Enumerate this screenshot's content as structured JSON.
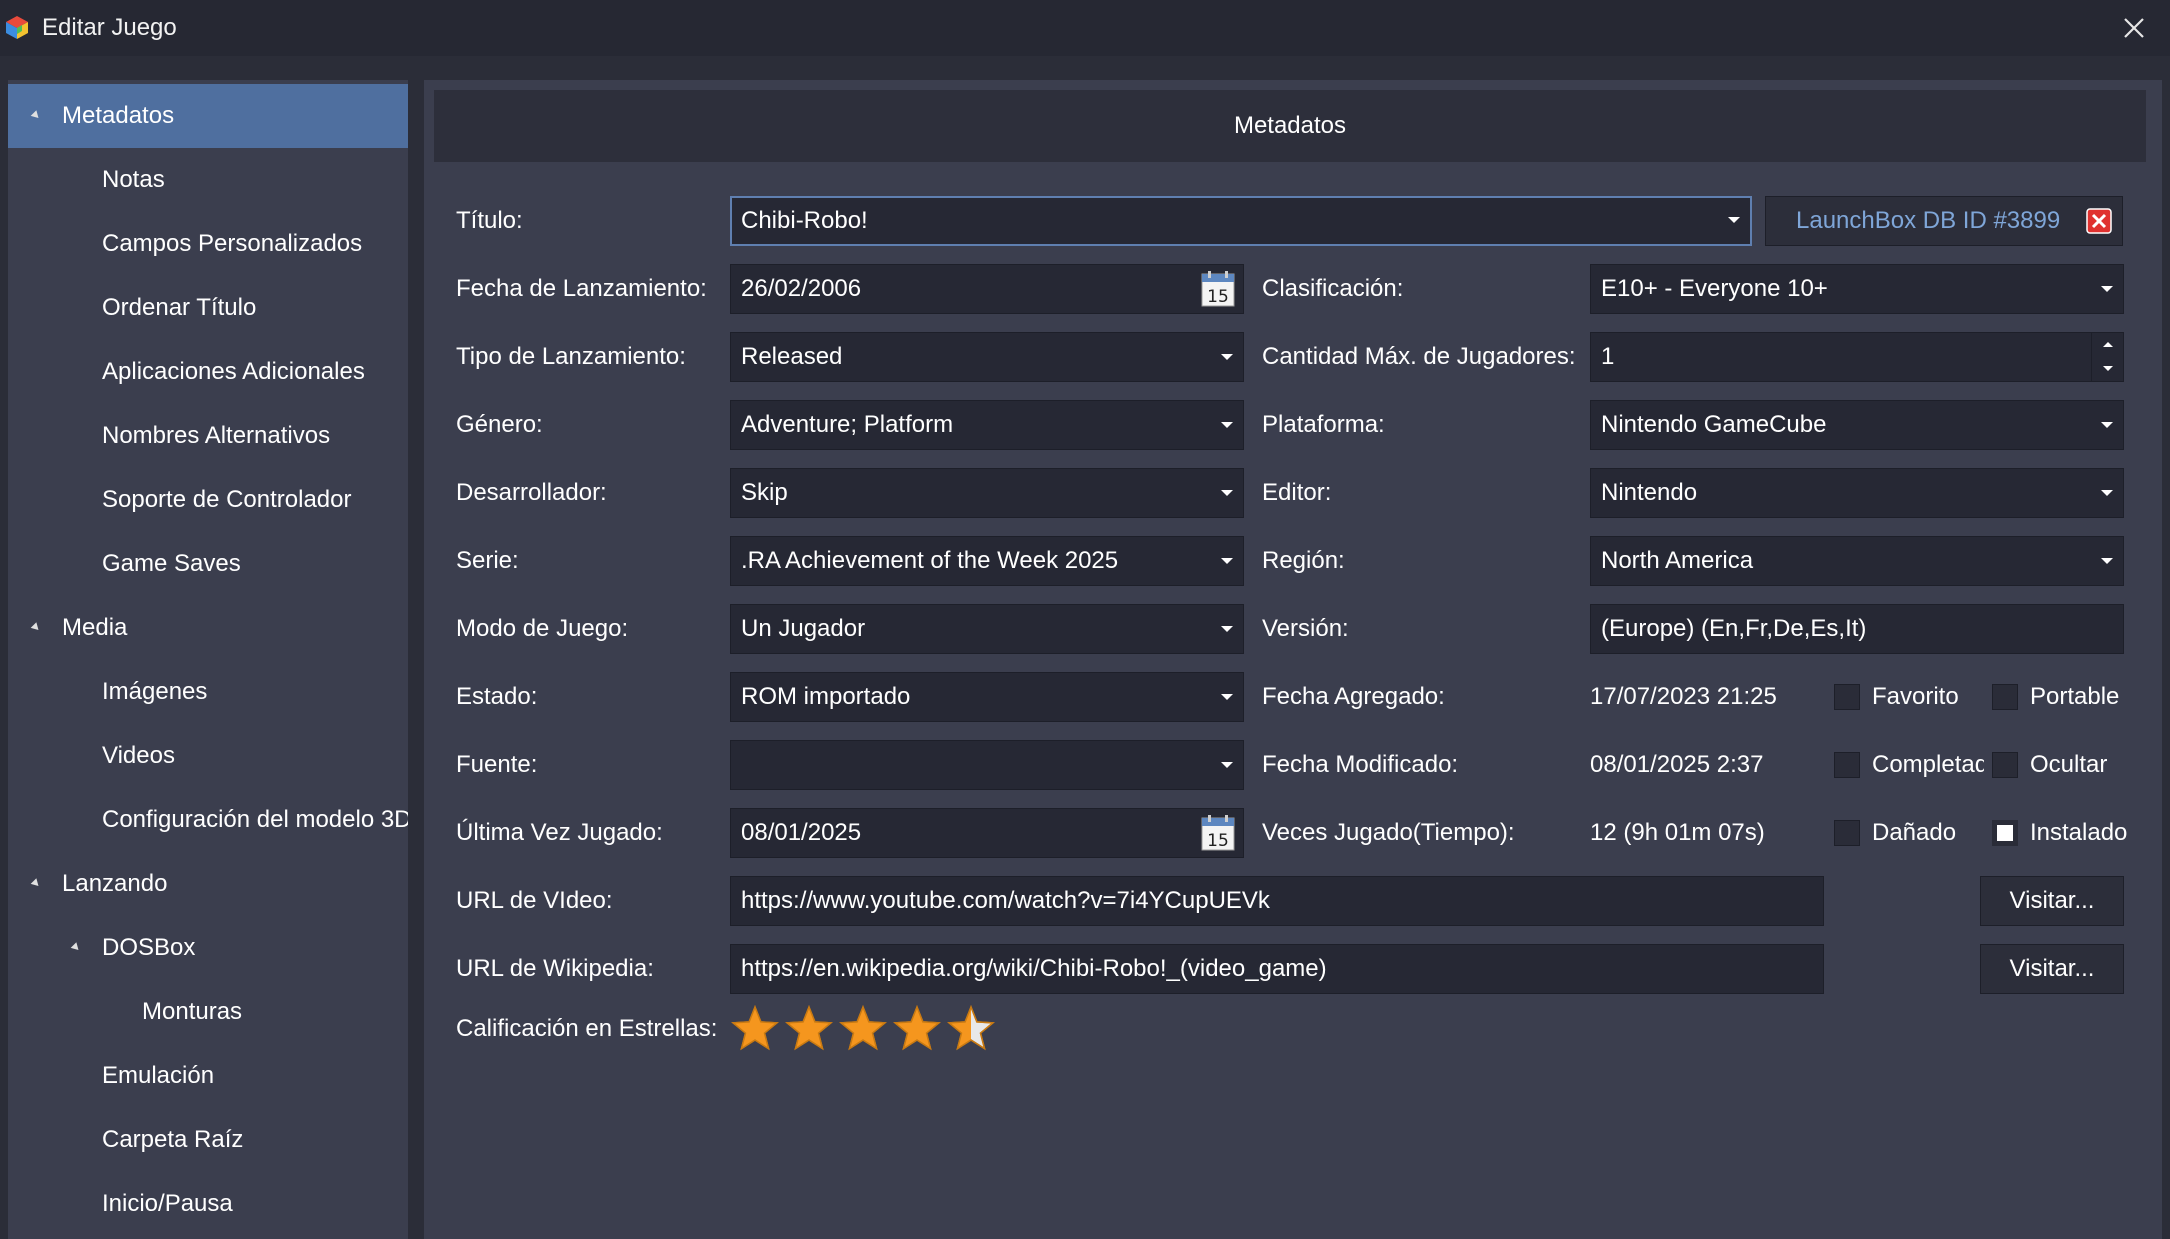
{
  "window": {
    "title": "Editar Juego",
    "app_icon": "launchbox-cube-icon",
    "close_icon": "close-icon"
  },
  "sidebar": {
    "items": [
      {
        "label": "Metadatos",
        "level": 0,
        "expanded": true,
        "selected": true
      },
      {
        "label": "Notas",
        "level": 1
      },
      {
        "label": "Campos Personalizados",
        "level": 1
      },
      {
        "label": "Ordenar Título",
        "level": 1
      },
      {
        "label": "Aplicaciones Adicionales",
        "level": 1
      },
      {
        "label": "Nombres Alternativos",
        "level": 1
      },
      {
        "label": "Soporte de Controlador",
        "level": 1
      },
      {
        "label": "Game Saves",
        "level": 1
      },
      {
        "label": "Media",
        "level": 0,
        "expanded": true
      },
      {
        "label": "Imágenes",
        "level": 1
      },
      {
        "label": "Videos",
        "level": 1
      },
      {
        "label": "Configuración del modelo 3D",
        "level": 1
      },
      {
        "label": "Lanzando",
        "level": 0,
        "expanded": true
      },
      {
        "label": "DOSBox",
        "level": 1,
        "expanded": true
      },
      {
        "label": "Monturas",
        "level": 2
      },
      {
        "label": "Emulación",
        "level": 1
      },
      {
        "label": "Carpeta Raíz",
        "level": 1
      },
      {
        "label": "Inicio/Pausa",
        "level": 1
      }
    ]
  },
  "panel": {
    "title": "Metadatos"
  },
  "form": {
    "title": {
      "label": "Título:",
      "value": "Chibi-Robo!"
    },
    "launchbox_db": {
      "label": "LaunchBox DB ID #3899"
    },
    "release_date": {
      "label": "Fecha de Lanzamiento:",
      "value": "26/02/2006",
      "calendar_day": "15"
    },
    "rating": {
      "label": "Clasificación:",
      "value": "E10+ - Everyone 10+"
    },
    "release_type": {
      "label": "Tipo de Lanzamiento:",
      "value": "Released"
    },
    "max_players": {
      "label": "Cantidad Máx. de Jugadores:",
      "value": "1"
    },
    "genre": {
      "label": "Género:",
      "value": "Adventure; Platform"
    },
    "platform": {
      "label": "Plataforma:",
      "value": "Nintendo GameCube"
    },
    "developer": {
      "label": "Desarrollador:",
      "value": "Skip"
    },
    "publisher": {
      "label": "Editor:",
      "value": "Nintendo"
    },
    "series": {
      "label": "Serie:",
      "value": ".RA Achievement of the Week 2025"
    },
    "region": {
      "label": "Región:",
      "value": "North America"
    },
    "play_mode": {
      "label": "Modo de Juego:",
      "value": "Un Jugador"
    },
    "version": {
      "label": "Versión:",
      "value": "(Europe) (En,Fr,De,Es,It)"
    },
    "status": {
      "label": "Estado:",
      "value": "ROM importado"
    },
    "date_added": {
      "label": "Fecha Agregado:",
      "value": "17/07/2023 21:25"
    },
    "source": {
      "label": "Fuente:",
      "value": ""
    },
    "date_modified": {
      "label": "Fecha Modificado:",
      "value": "08/01/2025 2:37"
    },
    "last_played": {
      "label": "Última Vez Jugado:",
      "value": "08/01/2025",
      "calendar_day": "15"
    },
    "play_count": {
      "label": "Veces Jugado(Tiempo):",
      "value": "12 (9h 01m 07s)"
    },
    "video_url": {
      "label": "URL de VIdeo:",
      "value": "https://www.youtube.com/watch?v=7i4YCupUEVk",
      "button": "Visitar..."
    },
    "wikipedia_url": {
      "label": "URL de Wikipedia:",
      "value": "https://en.wikipedia.org/wiki/Chibi-Robo!_(video_game)",
      "button": "Visitar..."
    },
    "star_rating": {
      "label": "Calificación en Estrellas:",
      "value": 4.5,
      "max": 5
    }
  },
  "checkboxes": {
    "favorite": {
      "label": "Favorito",
      "checked": false
    },
    "portable": {
      "label": "Portable",
      "checked": false
    },
    "completed": {
      "label": "Completado",
      "checked": false
    },
    "hide": {
      "label": "Ocultar",
      "checked": false
    },
    "broken": {
      "label": "Dañado",
      "checked": false
    },
    "installed": {
      "label": "Instalado",
      "checked": true
    }
  },
  "colors": {
    "background": "#2b2d38",
    "panel": "#3b3e4e",
    "field": "#262834",
    "selected": "#4f6f9f",
    "link": "#7fa6d8",
    "star": "#f5961e"
  }
}
